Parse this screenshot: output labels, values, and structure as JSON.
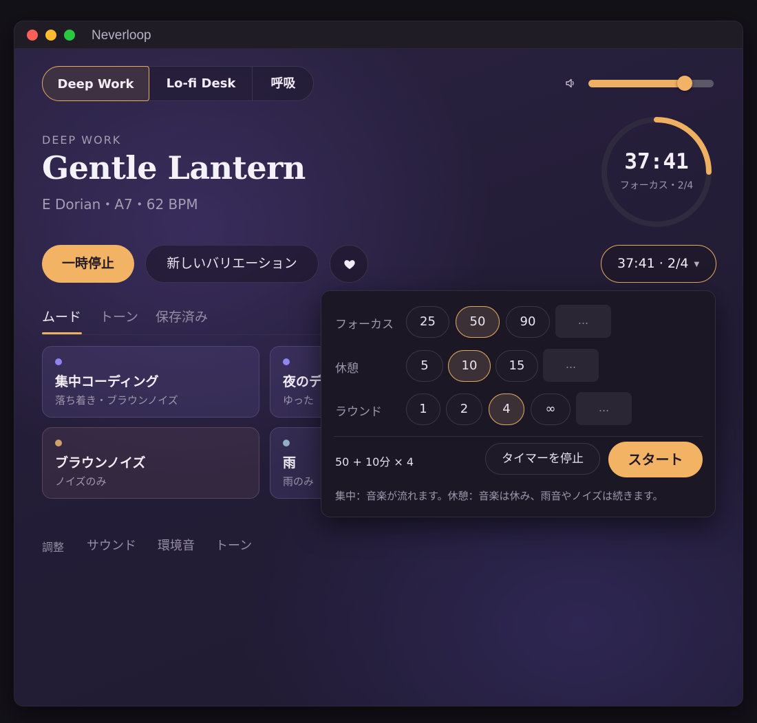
{
  "window": {
    "title": "Neverloop"
  },
  "presets": [
    {
      "label": "Deep Work",
      "active": true
    },
    {
      "label": "Lo-fi Desk",
      "active": false
    },
    {
      "label": "呼吸",
      "active": false
    }
  ],
  "volume": {
    "level": 0.77,
    "icon": "speaker-icon"
  },
  "track": {
    "eyebrow": "DEEP WORK",
    "title": "Gentle Lantern",
    "subtitle": "E Dorian・A7・62 BPM"
  },
  "timer_ring": {
    "time": "37:41",
    "sub": "フォーカス・2/4",
    "progress": 0.25
  },
  "actions": {
    "pause_label": "一時停止",
    "variation_label": "新しいバリエーション",
    "favorite_icon": "heart-icon",
    "timer_label": "37:41 · 2/4"
  },
  "tabs": [
    {
      "label": "ムード",
      "active": true
    },
    {
      "label": "トーン",
      "active": false
    },
    {
      "label": "保存済み",
      "active": false
    }
  ],
  "cards": [
    {
      "title": "集中コーディング",
      "subtitle": "落ち着き・ブラウンノイズ",
      "dot_color": "#8f85f0"
    },
    {
      "title": "夜のデ",
      "subtitle": "ゆった",
      "dot_color": "#8f85f0"
    },
    {
      "title": "ブラウンノイズ",
      "subtitle": "ノイズのみ",
      "dot_color": "#d2a06a"
    },
    {
      "title": "雨",
      "subtitle": "雨のみ",
      "dot_color": "#8fb0c8"
    }
  ],
  "footer_tabs": [
    "調整",
    "サウンド",
    "環境音",
    "トーン"
  ],
  "timer_popover": {
    "focus": {
      "label": "フォーカス",
      "options": [
        "25",
        "50",
        "90"
      ],
      "selected": "50",
      "more": "..."
    },
    "break": {
      "label": "休憩",
      "options": [
        "5",
        "10",
        "15"
      ],
      "selected": "10",
      "more": "..."
    },
    "rounds": {
      "label": "ラウンド",
      "options": [
        "1",
        "2",
        "4",
        "∞"
      ],
      "selected": "4",
      "more": "..."
    },
    "summary": "50 + 10分 × 4",
    "stop_label": "タイマーを停止",
    "start_label": "スタート",
    "note": "集中：音楽が流れます。休憩：音楽は休み、雨音やノイズは続きます。"
  },
  "colors": {
    "accent": "#f2b365",
    "background": "#241d37"
  }
}
